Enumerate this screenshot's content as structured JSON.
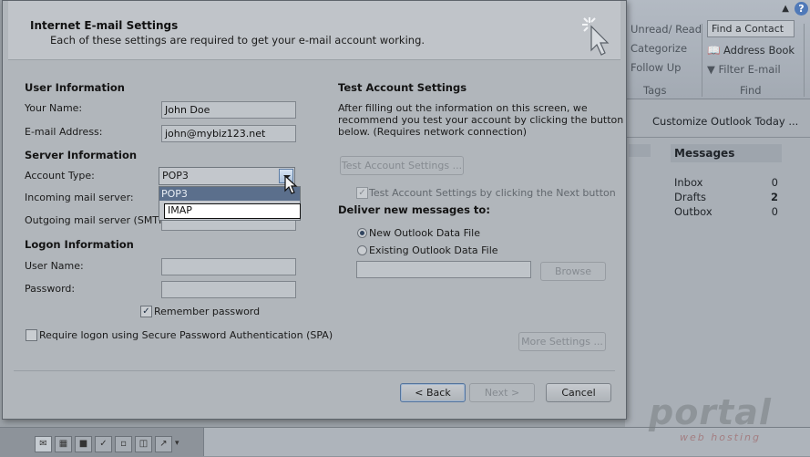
{
  "background_app": {
    "ribbon": {
      "tags": {
        "unread_read": "Unread/ Read",
        "categorize": "Categorize",
        "follow_up": "Follow Up",
        "group": "Tags"
      },
      "find": {
        "find_contact": "Find a Contact",
        "address_book": "Address Book",
        "filter_email": "Filter E-mail",
        "group": "Find"
      },
      "help": "?"
    },
    "customize_link": "Customize Outlook Today ...",
    "messages": {
      "title": "Messages",
      "rows": [
        {
          "name": "Inbox",
          "count": "0"
        },
        {
          "name": "Drafts",
          "count": "2"
        },
        {
          "name": "Outbox",
          "count": "0"
        }
      ]
    },
    "watermark": {
      "text": "portal",
      "subtext": "web hosting"
    }
  },
  "dialog": {
    "title": "Internet E-mail Settings",
    "subtitle": "Each of these settings are required to get your e-mail account working.",
    "user_info": {
      "title": "User Information",
      "name_label": "Your Name:",
      "name_value": "John Doe",
      "email_label": "E-mail Address:",
      "email_value": "john@mybiz123.net"
    },
    "server_info": {
      "title": "Server Information",
      "account_type_label": "Account Type:",
      "account_type_value": "POP3",
      "options": [
        "POP3",
        "IMAP"
      ],
      "incoming_label": "Incoming mail server:",
      "outgoing_label": "Outgoing mail server (SMTP):"
    },
    "logon_info": {
      "title": "Logon Information",
      "username_label": "User Name:",
      "password_label": "Password:",
      "remember_label": "Remember password",
      "remember_checked": true,
      "spa_label": "Require logon using Secure Password Authentication (SPA)",
      "spa_checked": false
    },
    "test_settings": {
      "title": "Test Account Settings",
      "description": [
        "After filling out the information on this screen, we",
        "recommend you test your account by clicking the button",
        "below. (Requires network connection)"
      ],
      "test_button": "Test Account Settings ...",
      "test_next_label": "Test Account Settings by clicking the Next button"
    },
    "deliver": {
      "title": "Deliver new messages to:",
      "new_file_label": "New Outlook Data File",
      "existing_file_label": "Existing Outlook Data File",
      "browse_button": "Browse"
    },
    "more_settings_button": "More Settings ...",
    "footer": {
      "back": "< Back",
      "next": "Next >",
      "cancel": "Cancel"
    }
  }
}
